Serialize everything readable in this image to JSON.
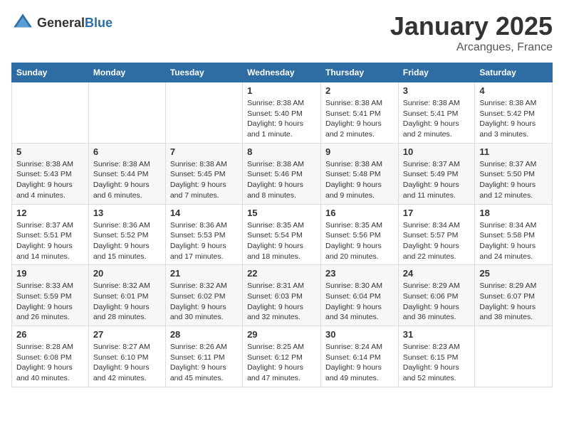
{
  "header": {
    "logo": {
      "text_general": "General",
      "text_blue": "Blue"
    },
    "month_title": "January 2025",
    "location": "Arcangues, France"
  },
  "columns": [
    "Sunday",
    "Monday",
    "Tuesday",
    "Wednesday",
    "Thursday",
    "Friday",
    "Saturday"
  ],
  "weeks": [
    [
      {
        "day": "",
        "info": ""
      },
      {
        "day": "",
        "info": ""
      },
      {
        "day": "",
        "info": ""
      },
      {
        "day": "1",
        "info": "Sunrise: 8:38 AM\nSunset: 5:40 PM\nDaylight: 9 hours\nand 1 minute."
      },
      {
        "day": "2",
        "info": "Sunrise: 8:38 AM\nSunset: 5:41 PM\nDaylight: 9 hours\nand 2 minutes."
      },
      {
        "day": "3",
        "info": "Sunrise: 8:38 AM\nSunset: 5:41 PM\nDaylight: 9 hours\nand 2 minutes."
      },
      {
        "day": "4",
        "info": "Sunrise: 8:38 AM\nSunset: 5:42 PM\nDaylight: 9 hours\nand 3 minutes."
      }
    ],
    [
      {
        "day": "5",
        "info": "Sunrise: 8:38 AM\nSunset: 5:43 PM\nDaylight: 9 hours\nand 4 minutes."
      },
      {
        "day": "6",
        "info": "Sunrise: 8:38 AM\nSunset: 5:44 PM\nDaylight: 9 hours\nand 6 minutes."
      },
      {
        "day": "7",
        "info": "Sunrise: 8:38 AM\nSunset: 5:45 PM\nDaylight: 9 hours\nand 7 minutes."
      },
      {
        "day": "8",
        "info": "Sunrise: 8:38 AM\nSunset: 5:46 PM\nDaylight: 9 hours\nand 8 minutes."
      },
      {
        "day": "9",
        "info": "Sunrise: 8:38 AM\nSunset: 5:48 PM\nDaylight: 9 hours\nand 9 minutes."
      },
      {
        "day": "10",
        "info": "Sunrise: 8:37 AM\nSunset: 5:49 PM\nDaylight: 9 hours\nand 11 minutes."
      },
      {
        "day": "11",
        "info": "Sunrise: 8:37 AM\nSunset: 5:50 PM\nDaylight: 9 hours\nand 12 minutes."
      }
    ],
    [
      {
        "day": "12",
        "info": "Sunrise: 8:37 AM\nSunset: 5:51 PM\nDaylight: 9 hours\nand 14 minutes."
      },
      {
        "day": "13",
        "info": "Sunrise: 8:36 AM\nSunset: 5:52 PM\nDaylight: 9 hours\nand 15 minutes."
      },
      {
        "day": "14",
        "info": "Sunrise: 8:36 AM\nSunset: 5:53 PM\nDaylight: 9 hours\nand 17 minutes."
      },
      {
        "day": "15",
        "info": "Sunrise: 8:35 AM\nSunset: 5:54 PM\nDaylight: 9 hours\nand 18 minutes."
      },
      {
        "day": "16",
        "info": "Sunrise: 8:35 AM\nSunset: 5:56 PM\nDaylight: 9 hours\nand 20 minutes."
      },
      {
        "day": "17",
        "info": "Sunrise: 8:34 AM\nSunset: 5:57 PM\nDaylight: 9 hours\nand 22 minutes."
      },
      {
        "day": "18",
        "info": "Sunrise: 8:34 AM\nSunset: 5:58 PM\nDaylight: 9 hours\nand 24 minutes."
      }
    ],
    [
      {
        "day": "19",
        "info": "Sunrise: 8:33 AM\nSunset: 5:59 PM\nDaylight: 9 hours\nand 26 minutes."
      },
      {
        "day": "20",
        "info": "Sunrise: 8:32 AM\nSunset: 6:01 PM\nDaylight: 9 hours\nand 28 minutes."
      },
      {
        "day": "21",
        "info": "Sunrise: 8:32 AM\nSunset: 6:02 PM\nDaylight: 9 hours\nand 30 minutes."
      },
      {
        "day": "22",
        "info": "Sunrise: 8:31 AM\nSunset: 6:03 PM\nDaylight: 9 hours\nand 32 minutes."
      },
      {
        "day": "23",
        "info": "Sunrise: 8:30 AM\nSunset: 6:04 PM\nDaylight: 9 hours\nand 34 minutes."
      },
      {
        "day": "24",
        "info": "Sunrise: 8:29 AM\nSunset: 6:06 PM\nDaylight: 9 hours\nand 36 minutes."
      },
      {
        "day": "25",
        "info": "Sunrise: 8:29 AM\nSunset: 6:07 PM\nDaylight: 9 hours\nand 38 minutes."
      }
    ],
    [
      {
        "day": "26",
        "info": "Sunrise: 8:28 AM\nSunset: 6:08 PM\nDaylight: 9 hours\nand 40 minutes."
      },
      {
        "day": "27",
        "info": "Sunrise: 8:27 AM\nSunset: 6:10 PM\nDaylight: 9 hours\nand 42 minutes."
      },
      {
        "day": "28",
        "info": "Sunrise: 8:26 AM\nSunset: 6:11 PM\nDaylight: 9 hours\nand 45 minutes."
      },
      {
        "day": "29",
        "info": "Sunrise: 8:25 AM\nSunset: 6:12 PM\nDaylight: 9 hours\nand 47 minutes."
      },
      {
        "day": "30",
        "info": "Sunrise: 8:24 AM\nSunset: 6:14 PM\nDaylight: 9 hours\nand 49 minutes."
      },
      {
        "day": "31",
        "info": "Sunrise: 8:23 AM\nSunset: 6:15 PM\nDaylight: 9 hours\nand 52 minutes."
      },
      {
        "day": "",
        "info": ""
      }
    ]
  ]
}
